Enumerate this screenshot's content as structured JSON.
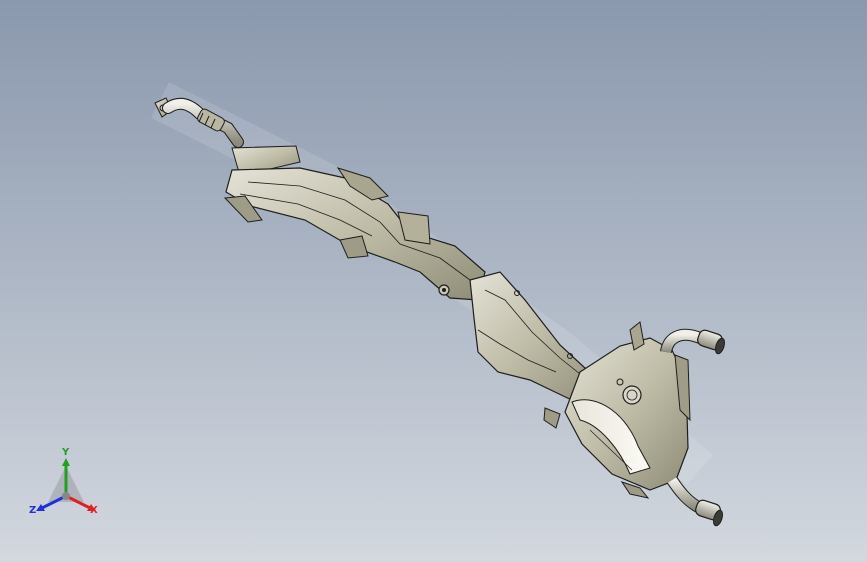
{
  "viewport": {
    "background_top": "#8a98ad",
    "background_bottom": "#d3d8df"
  },
  "model": {
    "part_color": "#c9c6b3",
    "edge_color": "#1e1e1e"
  },
  "triad": {
    "x_label": "X",
    "y_label": "Y",
    "z_label": "Z",
    "x_color": "#e02020",
    "y_color": "#22a022",
    "z_color": "#2030e0"
  }
}
